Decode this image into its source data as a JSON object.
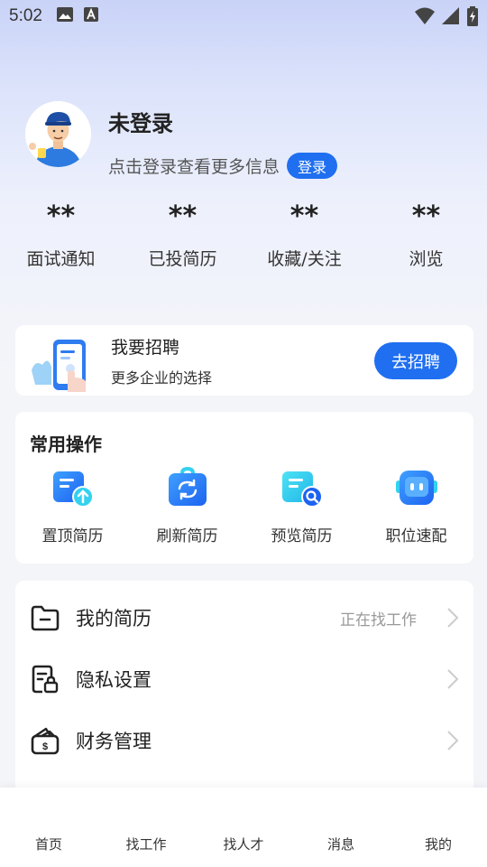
{
  "status_bar": {
    "time": "5:02",
    "icons": [
      "image-icon",
      "font-a-icon",
      "wifi-icon",
      "signal-icon",
      "battery-charging-icon"
    ]
  },
  "profile": {
    "name": "未登录",
    "hint": "点击登录查看更多信息",
    "login_label": "登录"
  },
  "stats": [
    {
      "value": "**",
      "label": "面试通知"
    },
    {
      "value": "**",
      "label": "已投简历"
    },
    {
      "value": "**",
      "label": "收藏/关注"
    },
    {
      "value": "**",
      "label": "浏览"
    }
  ],
  "recruit": {
    "title": "我要招聘",
    "subtitle": "更多企业的选择",
    "button_label": "去招聘"
  },
  "operations": {
    "title": "常用操作",
    "items": [
      {
        "label": "置顶简历",
        "icon": "pin-resume-icon"
      },
      {
        "label": "刷新简历",
        "icon": "refresh-resume-icon"
      },
      {
        "label": "预览简历",
        "icon": "preview-resume-icon"
      },
      {
        "label": "职位速配",
        "icon": "job-match-icon"
      }
    ]
  },
  "menu": [
    {
      "label": "我的简历",
      "value": "正在找工作",
      "icon": "folder-icon"
    },
    {
      "label": "隐私设置",
      "value": "",
      "icon": "privacy-lock-icon"
    },
    {
      "label": "财务管理",
      "value": "",
      "icon": "wallet-icon"
    }
  ],
  "tabs": [
    "首页",
    "找工作",
    "找人才",
    "消息",
    "我的"
  ],
  "colors": {
    "accent": "#1f6ff0",
    "icon_gradient_start": "#3fa0ff",
    "icon_gradient_end": "#1d63f0",
    "icon_cyan": "#34d1f0"
  }
}
